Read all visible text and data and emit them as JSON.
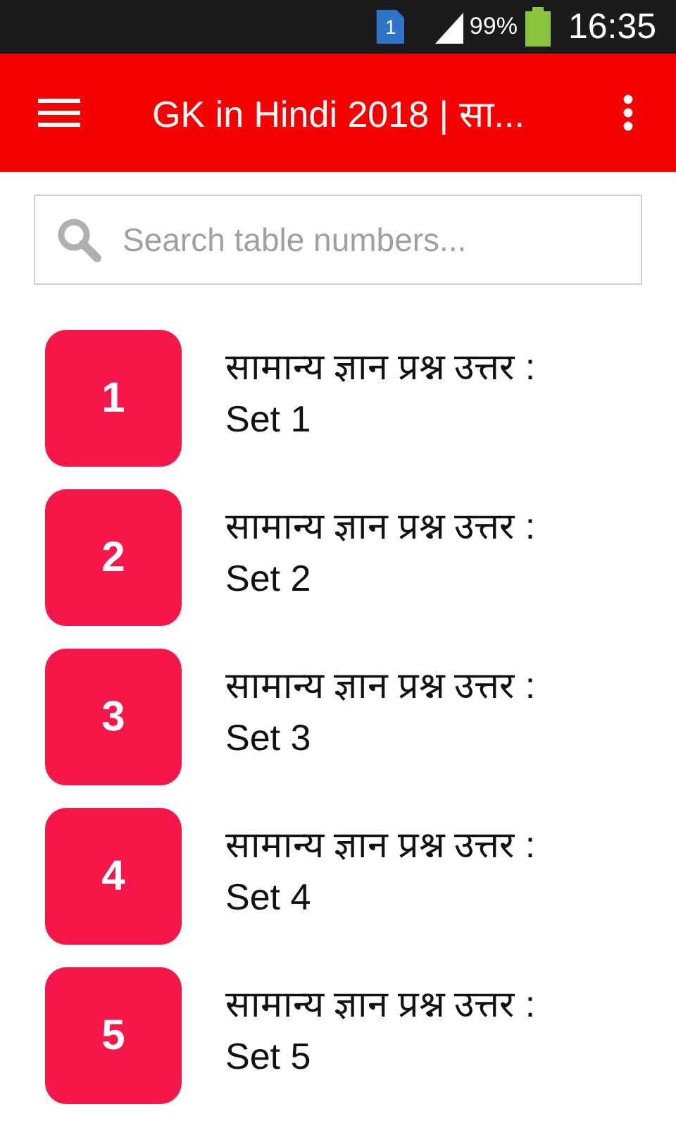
{
  "status_bar": {
    "notification": "1",
    "battery": "99%",
    "time": "16:35"
  },
  "toolbar": {
    "title": "GK in Hindi 2018 | सा..."
  },
  "search": {
    "placeholder": "Search table numbers..."
  },
  "items": [
    {
      "number": "1",
      "title": "सामान्य ज्ञान प्रश्न उत्तर : Set 1"
    },
    {
      "number": "2",
      "title": "सामान्य ज्ञान प्रश्न उत्तर : Set 2"
    },
    {
      "number": "3",
      "title": "सामान्य ज्ञान प्रश्न उत्तर : Set 3"
    },
    {
      "number": "4",
      "title": "सामान्य ज्ञान प्रश्न उत्तर : Set 4"
    },
    {
      "number": "5",
      "title": "सामान्य ज्ञान प्रश्न उत्तर : Set 5"
    }
  ]
}
